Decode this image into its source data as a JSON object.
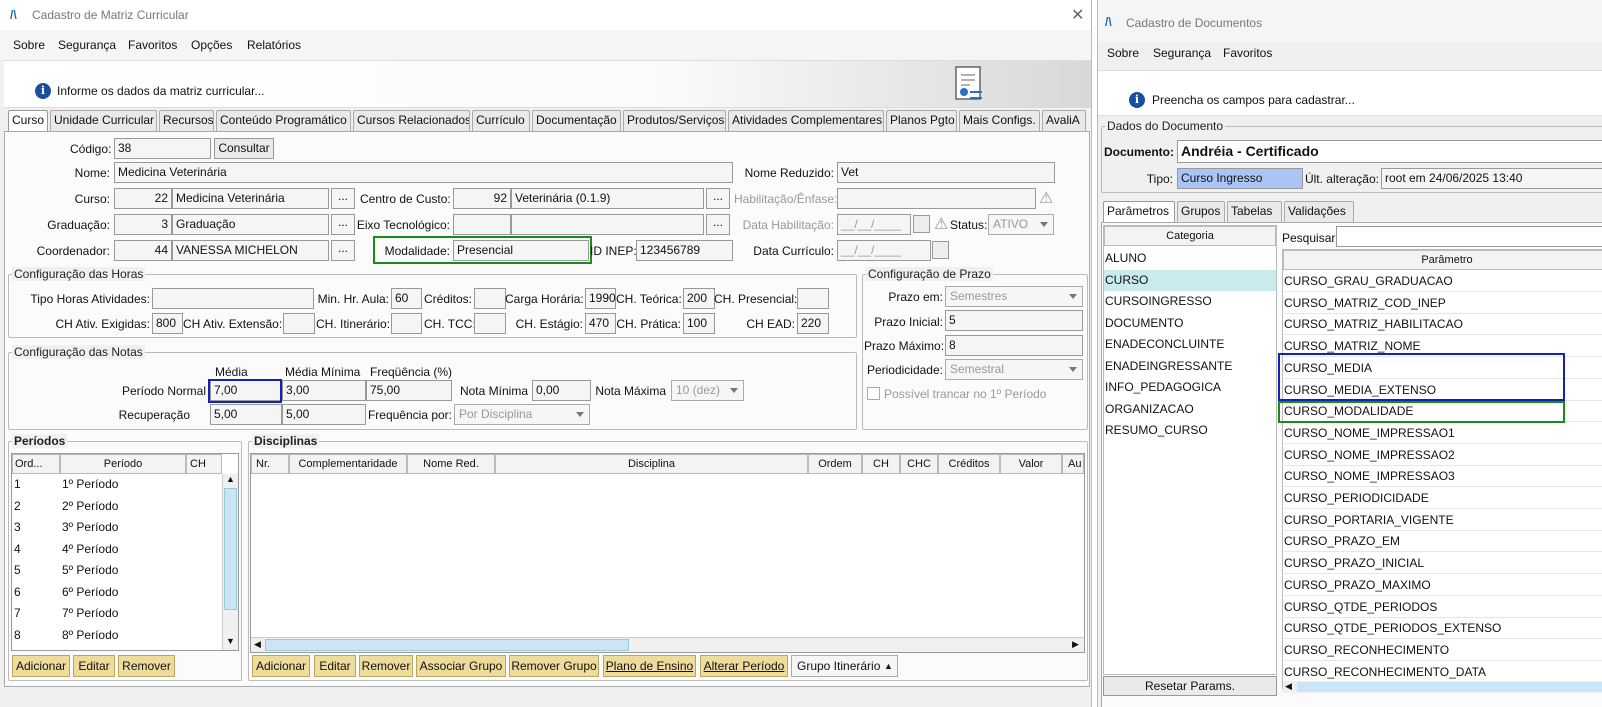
{
  "w1": {
    "title": "Cadastro de Matriz Curricular",
    "menu": [
      "Sobre",
      "Segurança",
      "Favoritos",
      "Opções",
      "Relatórios"
    ],
    "info": "Informe os dados da matriz curricular...",
    "tabs": [
      "Curso",
      "Unidade Curricular",
      "Recursos",
      "Conteúdo Programático",
      "Cursos Relacionados",
      "Currículo",
      "Documentação",
      "Produtos/Serviços",
      "Atividades Complementares",
      "Planos Pgto",
      "Mais Configs.",
      "AvaliA"
    ],
    "labels": {
      "codigo": "Código:",
      "nome": "Nome:",
      "curso": "Curso:",
      "graduacao": "Graduação:",
      "coordenador": "Coordenador:",
      "nome_reduzido": "Nome Reduzido:",
      "centro_custo": "Centro de Custo:",
      "habilitacao": "Habilitação/Ênfase:",
      "eixo": "Eixo Tecnológico:",
      "data_hab": "Data Habilitação:",
      "status": "Status:",
      "modalidade": "Modalidade:",
      "id_inep": "ID INEP:",
      "data_curriculo": "Data Currículo:",
      "consultar": "Consultar",
      "dots": "..."
    },
    "fields": {
      "codigo": "38",
      "nome": "Medicina Veterinária",
      "curso_cod": "22",
      "curso_nome": "Medicina Veterinária",
      "grad_cod": "3",
      "grad_nome": "Graduação",
      "coord_cod": "44",
      "coord_nome": "VANESSA MICHELON",
      "nome_reduzido": "Vet",
      "cc_cod": "92",
      "cc_nome": "Veterinária (0.1.9)",
      "habilitacao": "",
      "eixo_cod": "",
      "eixo_nome": "",
      "data_hab": "__/__/____",
      "status": "ATIVO",
      "modalidade": "Presencial",
      "id_inep": "123456789",
      "data_curriculo": "__/__/____"
    },
    "horas": {
      "title": "Configuração das Horas",
      "l_tipo": "Tipo Horas Atividades:",
      "tipo": "",
      "l_minhr": "Min. Hr. Aula:",
      "minhr": "60",
      "l_creditos": "Créditos:",
      "creditos": "",
      "l_carga": "Carga Horária:",
      "carga": "1990",
      "l_teorica": "CH. Teórica:",
      "teorica": "200",
      "l_presencial": "CH. Presencial:",
      "presencial": "",
      "l_ativ": "CH Ativ. Exigidas:",
      "ativ": "800",
      "l_ext": "CH Ativ. Extensão:",
      "ext": "",
      "l_itin": "CH. Itinerário:",
      "itin": "",
      "l_tcc": "CH. TCC:",
      "tcc": "",
      "l_estagio": "CH. Estágio:",
      "estagio": "470",
      "l_pratica": "CH. Prática:",
      "pratica": "100",
      "l_ead": "CH EAD:",
      "ead": "220"
    },
    "prazo": {
      "title": "Configuração de Prazo",
      "l_em": "Prazo em:",
      "em": "Semestres",
      "l_ini": "Prazo Inicial:",
      "ini": "5",
      "l_max": "Prazo Máximo:",
      "max": "8",
      "l_per": "Periodicidade:",
      "per": "Semestral",
      "trancar": "Possível trancar no 1º Período"
    },
    "notas": {
      "title": "Configuração das Notas",
      "h_media": "Média",
      "h_min": "Média Mínima",
      "h_freq": "Freqüência (%)",
      "l_normal": "Período Normal",
      "normal_media": "7,00",
      "normal_min": "3,00",
      "normal_freq": "75,00",
      "l_nmin": "Nota Mínima",
      "nmin": "0,00",
      "l_nmax": "Nota Máxima",
      "nmax": "10 (dez)",
      "l_rec": "Recuperação",
      "rec_media": "5,00",
      "rec_min": "5,00",
      "l_freqpor": "Frequência por:",
      "freqpor": "Por Disciplina"
    },
    "periodos": {
      "title": "Períodos",
      "cols": [
        "Ord...",
        "Período",
        "CH"
      ],
      "rows": [
        [
          "1",
          "1º Período"
        ],
        [
          "2",
          "2º Período"
        ],
        [
          "3",
          "3º Período"
        ],
        [
          "4",
          "4º Período"
        ],
        [
          "5",
          "5º Período"
        ],
        [
          "6",
          "6º Período"
        ],
        [
          "7",
          "7º Período"
        ],
        [
          "8",
          "8º Período"
        ]
      ],
      "buttons": [
        "Adicionar",
        "Editar",
        "Remover"
      ]
    },
    "disciplinas": {
      "title": "Disciplinas",
      "cols": [
        "Nr.",
        "Complementaridade",
        "Nome Red.",
        "Disciplina",
        "Ordem",
        "CH",
        "CHC",
        "Créditos",
        "Valor",
        "Au"
      ],
      "buttons": [
        "Adicionar",
        "Editar",
        "Remover",
        "Associar Grupo",
        "Remover Grupo",
        "Plano de Ensino",
        "Alterar Período"
      ],
      "grupo_itinerario": "Grupo Itinerário"
    }
  },
  "w2": {
    "title": "Cadastro de Documentos",
    "menu": [
      "Sobre",
      "Segurança",
      "Favoritos"
    ],
    "info": "Preencha os campos para cadastrar...",
    "group_title": "Dados do Documento",
    "l_doc": "Documento:",
    "doc": "Andréia - Certificado",
    "l_tipo": "Tipo:",
    "tipo": "Curso Ingresso",
    "l_ult": "Últ. alteração:",
    "ult": "root em 24/06/2025 13:40",
    "tabs": [
      "Parâmetros",
      "Grupos",
      "Tabelas",
      "Validações"
    ],
    "categoria_header": "Categoria",
    "categorias": [
      "ALUNO",
      "CURSO",
      "CURSOINGRESSO",
      "DOCUMENTO",
      "ENADECONCLUINTE",
      "ENADEINGRESSANTE",
      "INFO_PEDAGOGICA",
      "ORGANIZACAO",
      "RESUMO_CURSO"
    ],
    "pesquisar": "Pesquisar:",
    "param_header": "Parâmetro",
    "parametros": [
      "CURSO_GRAU_GRADUACAO",
      "CURSO_MATRIZ_COD_INEP",
      "CURSO_MATRIZ_HABILITACAO",
      "CURSO_MATRIZ_NOME",
      "CURSO_MEDIA",
      "CURSO_MEDIA_EXTENSO",
      "CURSO_MODALIDADE",
      "CURSO_NOME_IMPRESSAO1",
      "CURSO_NOME_IMPRESSAO2",
      "CURSO_NOME_IMPRESSAO3",
      "CURSO_PERIODICIDADE",
      "CURSO_PORTARIA_VIGENTE",
      "CURSO_PRAZO_EM",
      "CURSO_PRAZO_INICIAL",
      "CURSO_PRAZO_MAXIMO",
      "CURSO_QTDE_PERIODOS",
      "CURSO_QTDE_PERIODOS_EXTENSO",
      "CURSO_RECONHECIMENTO",
      "CURSO_RECONHECIMENTO_DATA"
    ],
    "resetar": "Resetar Params."
  },
  "colors": {
    "highlight_green": "#1a8a1a",
    "highlight_blue": "#1420b8",
    "button_yellow": "#eddc9c",
    "tipo_blue": "#a9c4f5",
    "selected_row": "#c9ebee"
  }
}
